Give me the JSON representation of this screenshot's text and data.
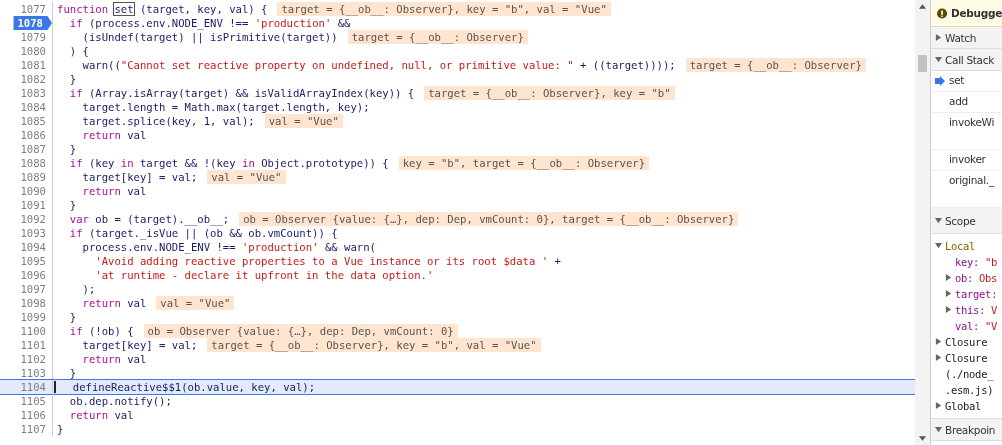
{
  "code": {
    "lines": [
      {
        "number": "1077",
        "breakpoint": false,
        "execution": false,
        "tokens": [
          {
            "kind": "kw",
            "text": "function "
          },
          {
            "kind": "boxed",
            "text": "set"
          },
          {
            "kind": "plain",
            "text": " (target, key, val) {"
          }
        ],
        "annotation": "target = {__ob__: Observer}, key = \"b\", val = \"Vue\""
      },
      {
        "number": "1078",
        "breakpoint": true,
        "execution": false,
        "tokens": [
          {
            "kind": "kw",
            "text": "  if"
          },
          {
            "kind": "plain",
            "text": " (process.env.NODE_ENV !== "
          },
          {
            "kind": "str",
            "text": "'production'"
          },
          {
            "kind": "plain",
            "text": " &&"
          }
        ]
      },
      {
        "number": "1079",
        "breakpoint": false,
        "execution": false,
        "tokens": [
          {
            "kind": "plain",
            "text": "    (isUndef(target) || isPrimitive(target))"
          }
        ],
        "annotation": "target = {__ob__: Observer}"
      },
      {
        "number": "1080",
        "breakpoint": false,
        "execution": false,
        "tokens": [
          {
            "kind": "plain",
            "text": "  ) {"
          }
        ]
      },
      {
        "number": "1081",
        "breakpoint": false,
        "execution": false,
        "tokens": [
          {
            "kind": "plain",
            "text": "    warn(("
          },
          {
            "kind": "str",
            "text": "\"Cannot set reactive property on undefined, null, or primitive value: \""
          },
          {
            "kind": "plain",
            "text": " + ((target))));"
          }
        ],
        "annotation": "target = {__ob__: Observer}"
      },
      {
        "number": "1082",
        "breakpoint": false,
        "execution": false,
        "tokens": [
          {
            "kind": "plain",
            "text": "  }"
          }
        ]
      },
      {
        "number": "1083",
        "breakpoint": false,
        "execution": false,
        "tokens": [
          {
            "kind": "kw",
            "text": "  if"
          },
          {
            "kind": "plain",
            "text": " (Array.isArray(target) && isValidArrayIndex(key)) {"
          }
        ],
        "annotation": "target = {__ob__: Observer}, key = \"b\""
      },
      {
        "number": "1084",
        "breakpoint": false,
        "execution": false,
        "tokens": [
          {
            "kind": "plain",
            "text": "    target.length = Math.max(target.length, key);"
          }
        ]
      },
      {
        "number": "1085",
        "breakpoint": false,
        "execution": false,
        "tokens": [
          {
            "kind": "plain",
            "text": "    target.splice(key, 1, val);"
          }
        ],
        "annotation": "val = \"Vue\""
      },
      {
        "number": "1086",
        "breakpoint": false,
        "execution": false,
        "tokens": [
          {
            "kind": "kw",
            "text": "    return"
          },
          {
            "kind": "plain",
            "text": " val"
          }
        ]
      },
      {
        "number": "1087",
        "breakpoint": false,
        "execution": false,
        "tokens": [
          {
            "kind": "plain",
            "text": "  }"
          }
        ]
      },
      {
        "number": "1088",
        "breakpoint": false,
        "execution": false,
        "tokens": [
          {
            "kind": "kw",
            "text": "  if"
          },
          {
            "kind": "plain",
            "text": " (key "
          },
          {
            "kind": "kw",
            "text": "in"
          },
          {
            "kind": "plain",
            "text": " target && !(key "
          },
          {
            "kind": "kw",
            "text": "in"
          },
          {
            "kind": "plain",
            "text": " Object.prototype)) {"
          }
        ],
        "annotation": "key = \"b\", target = {__ob__: Observer}"
      },
      {
        "number": "1089",
        "breakpoint": false,
        "execution": false,
        "tokens": [
          {
            "kind": "plain",
            "text": "    target[key] = val;"
          }
        ],
        "annotation": "val = \"Vue\""
      },
      {
        "number": "1090",
        "breakpoint": false,
        "execution": false,
        "tokens": [
          {
            "kind": "kw",
            "text": "    return"
          },
          {
            "kind": "plain",
            "text": " val"
          }
        ]
      },
      {
        "number": "1091",
        "breakpoint": false,
        "execution": false,
        "tokens": [
          {
            "kind": "plain",
            "text": "  }"
          }
        ]
      },
      {
        "number": "1092",
        "breakpoint": false,
        "execution": false,
        "tokens": [
          {
            "kind": "kw",
            "text": "  var"
          },
          {
            "kind": "plain",
            "text": " ob = (target).__ob__;"
          }
        ],
        "annotation": "ob = Observer {value: {…}, dep: Dep, vmCount: 0}, target = {__ob__: Observer}"
      },
      {
        "number": "1093",
        "breakpoint": false,
        "execution": false,
        "tokens": [
          {
            "kind": "kw",
            "text": "  if"
          },
          {
            "kind": "plain",
            "text": " (target._isVue || (ob && ob.vmCount)) {"
          }
        ]
      },
      {
        "number": "1094",
        "breakpoint": false,
        "execution": false,
        "tokens": [
          {
            "kind": "plain",
            "text": "    process.env.NODE_ENV !== "
          },
          {
            "kind": "str",
            "text": "'production'"
          },
          {
            "kind": "plain",
            "text": " && warn("
          }
        ]
      },
      {
        "number": "1095",
        "breakpoint": false,
        "execution": false,
        "tokens": [
          {
            "kind": "str",
            "text": "      'Avoid adding reactive properties to a Vue instance or its root $data '"
          },
          {
            "kind": "plain",
            "text": " +"
          }
        ]
      },
      {
        "number": "1096",
        "breakpoint": false,
        "execution": false,
        "tokens": [
          {
            "kind": "str",
            "text": "      'at runtime - declare it upfront in the data option.'"
          }
        ]
      },
      {
        "number": "1097",
        "breakpoint": false,
        "execution": false,
        "tokens": [
          {
            "kind": "plain",
            "text": "    );"
          }
        ]
      },
      {
        "number": "1098",
        "breakpoint": false,
        "execution": false,
        "tokens": [
          {
            "kind": "kw",
            "text": "    return"
          },
          {
            "kind": "plain",
            "text": " val"
          }
        ],
        "annotation": "val = \"Vue\""
      },
      {
        "number": "1099",
        "breakpoint": false,
        "execution": false,
        "tokens": [
          {
            "kind": "plain",
            "text": "  }"
          }
        ]
      },
      {
        "number": "1100",
        "breakpoint": false,
        "execution": false,
        "tokens": [
          {
            "kind": "kw",
            "text": "  if"
          },
          {
            "kind": "plain",
            "text": " (!ob) {"
          }
        ],
        "annotation": "ob = Observer {value: {…}, dep: Dep, vmCount: 0}"
      },
      {
        "number": "1101",
        "breakpoint": false,
        "execution": false,
        "tokens": [
          {
            "kind": "plain",
            "text": "    target[key] = val;"
          }
        ],
        "annotation": "target = {__ob__: Observer}, key = \"b\", val = \"Vue\""
      },
      {
        "number": "1102",
        "breakpoint": false,
        "execution": false,
        "tokens": [
          {
            "kind": "kw",
            "text": "    return"
          },
          {
            "kind": "plain",
            "text": " val"
          }
        ]
      },
      {
        "number": "1103",
        "breakpoint": false,
        "execution": false,
        "tokens": [
          {
            "kind": "plain",
            "text": "  }"
          }
        ]
      },
      {
        "number": "1104",
        "breakpoint": false,
        "execution": true,
        "tokens": [
          {
            "kind": "plain",
            "text": "  defineReactive$$1(ob.value, key, val);"
          }
        ]
      },
      {
        "number": "1105",
        "breakpoint": false,
        "execution": false,
        "tokens": [
          {
            "kind": "plain",
            "text": "  ob.dep.notify();"
          }
        ]
      },
      {
        "number": "1106",
        "breakpoint": false,
        "execution": false,
        "tokens": [
          {
            "kind": "kw",
            "text": "  return"
          },
          {
            "kind": "plain",
            "text": " val"
          }
        ]
      },
      {
        "number": "1107",
        "breakpoint": false,
        "execution": false,
        "tokens": [
          {
            "kind": "plain",
            "text": "}"
          }
        ]
      }
    ]
  },
  "sidebar": {
    "banner": "Debugge",
    "watch": {
      "title": "Watch",
      "expanded": false
    },
    "call_stack": {
      "title": "Call Stack",
      "expanded": true,
      "frames": [
        {
          "label": "set",
          "selected": true,
          "tall": false
        },
        {
          "label": "add",
          "selected": false,
          "tall": false
        },
        {
          "label": "invokeWi",
          "selected": false,
          "tall": true
        },
        {
          "label": "invoker",
          "selected": false,
          "tall": false
        },
        {
          "label": "original._",
          "selected": false,
          "tall": true
        }
      ]
    },
    "scope": {
      "title": "Scope",
      "expanded": true,
      "items": [
        {
          "label": "Local",
          "expanded": true,
          "children": [
            {
              "name": "key:",
              "value": "\"b",
              "expandable": false
            },
            {
              "name": "ob:",
              "value": "Obs",
              "expandable": true
            },
            {
              "name": "target:",
              "expandable": true
            },
            {
              "name": "this:",
              "value": "V",
              "expandable": true
            },
            {
              "name": "val:",
              "value": "\"V",
              "expandable": false
            }
          ]
        },
        {
          "label": "Closure",
          "expanded": false
        },
        {
          "label": "Closure (./node_ .esm.js)",
          "expanded": false
        },
        {
          "label": "Global",
          "expanded": false
        }
      ]
    },
    "breakpoints": {
      "title": "Breakpoin",
      "expanded": true
    }
  }
}
